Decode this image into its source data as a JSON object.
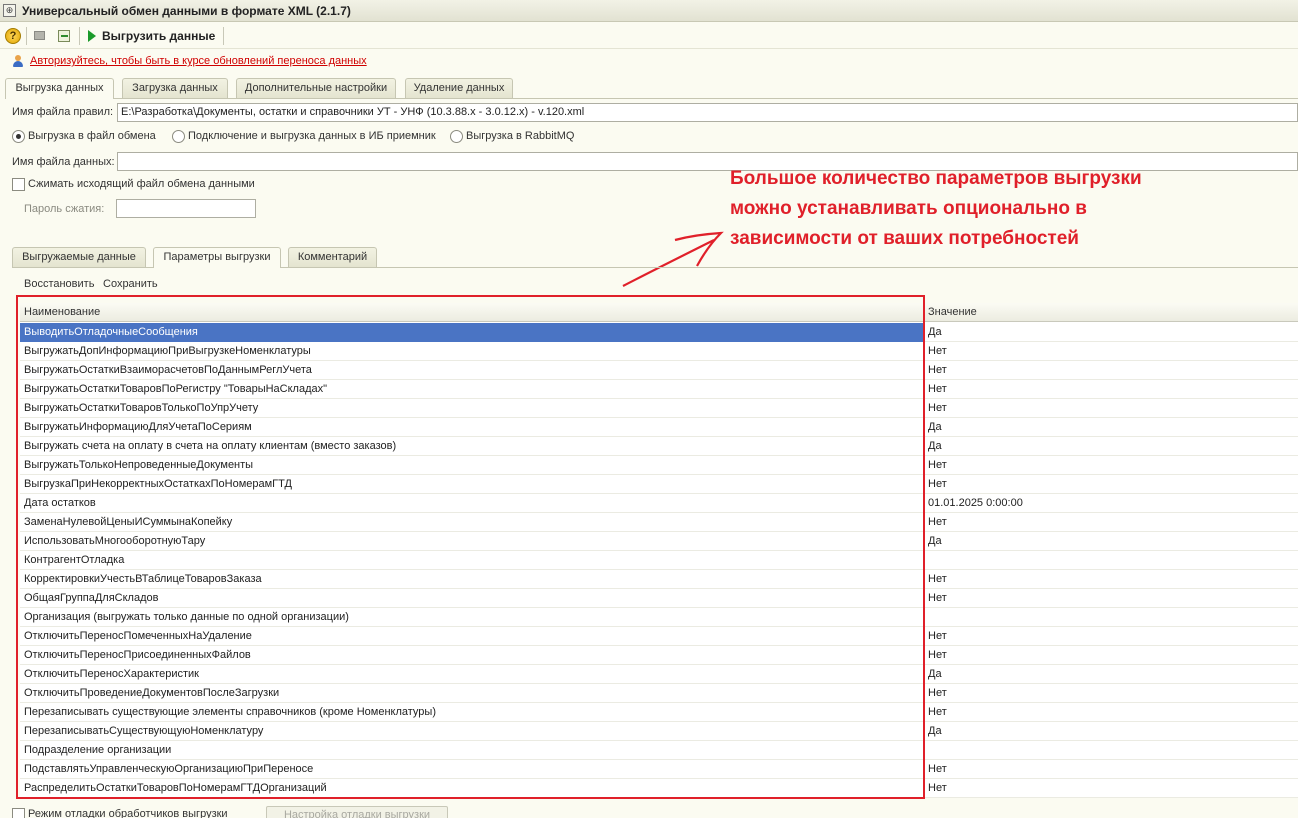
{
  "window": {
    "title": "Универсальный обмен данными в формате XML (2.1.7)"
  },
  "toolbar": {
    "export_label": "Выгрузить данные",
    "help_label": "?"
  },
  "auth_link": "Авторизуйтесь, чтобы быть в курсе обновлений переноса данных",
  "main_tabs": [
    "Выгрузка данных",
    "Загрузка данных",
    "Дополнительные настройки",
    "Удаление данных"
  ],
  "rules_file": {
    "label": "Имя файла правил:",
    "value": "E:\\Разработка\\Документы, остатки и справочники УТ - УНФ (10.3.88.x - 3.0.12.x) - v.120.xml"
  },
  "export_modes": [
    {
      "label": "Выгрузка в файл обмена",
      "selected": true
    },
    {
      "label": "Подключение и выгрузка данных в ИБ приемник",
      "selected": false
    },
    {
      "label": "Выгрузка в RabbitMQ",
      "selected": false
    }
  ],
  "data_file": {
    "label": "Имя файла данных:",
    "value": ""
  },
  "compress": {
    "label": "Сжимать исходящий файл обмена данными",
    "checked": false
  },
  "password": {
    "label": "Пароль сжатия:",
    "value": ""
  },
  "annotation": {
    "line1": "Большое количество параметров выгрузки",
    "line2": "можно устанавливать опционально в",
    "line3": "зависимости от ваших потребностей",
    "color": "#e0202a"
  },
  "sub_tabs": [
    "Выгружаемые данные",
    "Параметры выгрузки",
    "Комментарий"
  ],
  "commands": {
    "restore": "Восстановить",
    "save": "Сохранить"
  },
  "grid": {
    "col_name": "Наименование",
    "col_value": "Значение",
    "rows": [
      {
        "name": "ВыводитьОтладочныеСообщения",
        "value": "Да"
      },
      {
        "name": "ВыгружатьДопИнформациюПриВыгрузкеНоменклатуры",
        "value": "Нет"
      },
      {
        "name": "ВыгружатьОстаткиВзаиморасчетовПоДаннымРеглУчета",
        "value": "Нет"
      },
      {
        "name": "ВыгружатьОстаткиТоваровПоРегистру \"ТоварыНаСкладах\"",
        "value": "Нет"
      },
      {
        "name": "ВыгружатьОстаткиТоваровТолькоПоУпрУчету",
        "value": "Нет"
      },
      {
        "name": "ВыгружатьИнформациюДляУчетаПоСериям",
        "value": "Да"
      },
      {
        "name": "Выгружать счета на оплату в счета на оплату клиентам (вместо заказов)",
        "value": "Да"
      },
      {
        "name": "ВыгружатьТолькоНепроведенныеДокументы",
        "value": "Нет"
      },
      {
        "name": "ВыгрузкаПриНекорректныхОстаткахПоНомерамГТД",
        "value": "Нет"
      },
      {
        "name": "Дата остатков",
        "value": "01.01.2025 0:00:00"
      },
      {
        "name": "ЗаменаНулевойЦеныИСуммынаКопейку",
        "value": "Нет"
      },
      {
        "name": "ИспользоватьМногооборотнуюТару",
        "value": "Да"
      },
      {
        "name": "КонтрагентОтладка",
        "value": ""
      },
      {
        "name": "КорректировкиУчестьВТаблицеТоваровЗаказа",
        "value": "Нет"
      },
      {
        "name": "ОбщаяГруппаДляСкладов",
        "value": "Нет"
      },
      {
        "name": "Организация (выгружать только данные по одной организации)",
        "value": ""
      },
      {
        "name": "ОтключитьПереносПомеченныхНаУдаление",
        "value": "Нет"
      },
      {
        "name": "ОтключитьПереносПрисоединенныхФайлов",
        "value": "Нет"
      },
      {
        "name": "ОтключитьПереносХарактеристик",
        "value": "Да"
      },
      {
        "name": "ОтключитьПроведениеДокументовПослеЗагрузки",
        "value": "Нет"
      },
      {
        "name": "Перезаписывать существующие элементы справочников (кроме Номенклатуры)",
        "value": "Нет"
      },
      {
        "name": "ПерезаписыватьСуществующуюНоменклатуру",
        "value": "Да"
      },
      {
        "name": "Подразделение организации",
        "value": ""
      },
      {
        "name": "ПодставлятьУправленческуюОрганизациюПриПереносе",
        "value": "Нет"
      },
      {
        "name": "РаспределитьОстаткиТоваровПоНомерамГТДОрганизаций",
        "value": "Нет"
      }
    ]
  },
  "bottom": {
    "debug_mode": "Режим отладки обработчиков выгрузки",
    "debug_settings": "Настройка отладки выгрузки"
  }
}
